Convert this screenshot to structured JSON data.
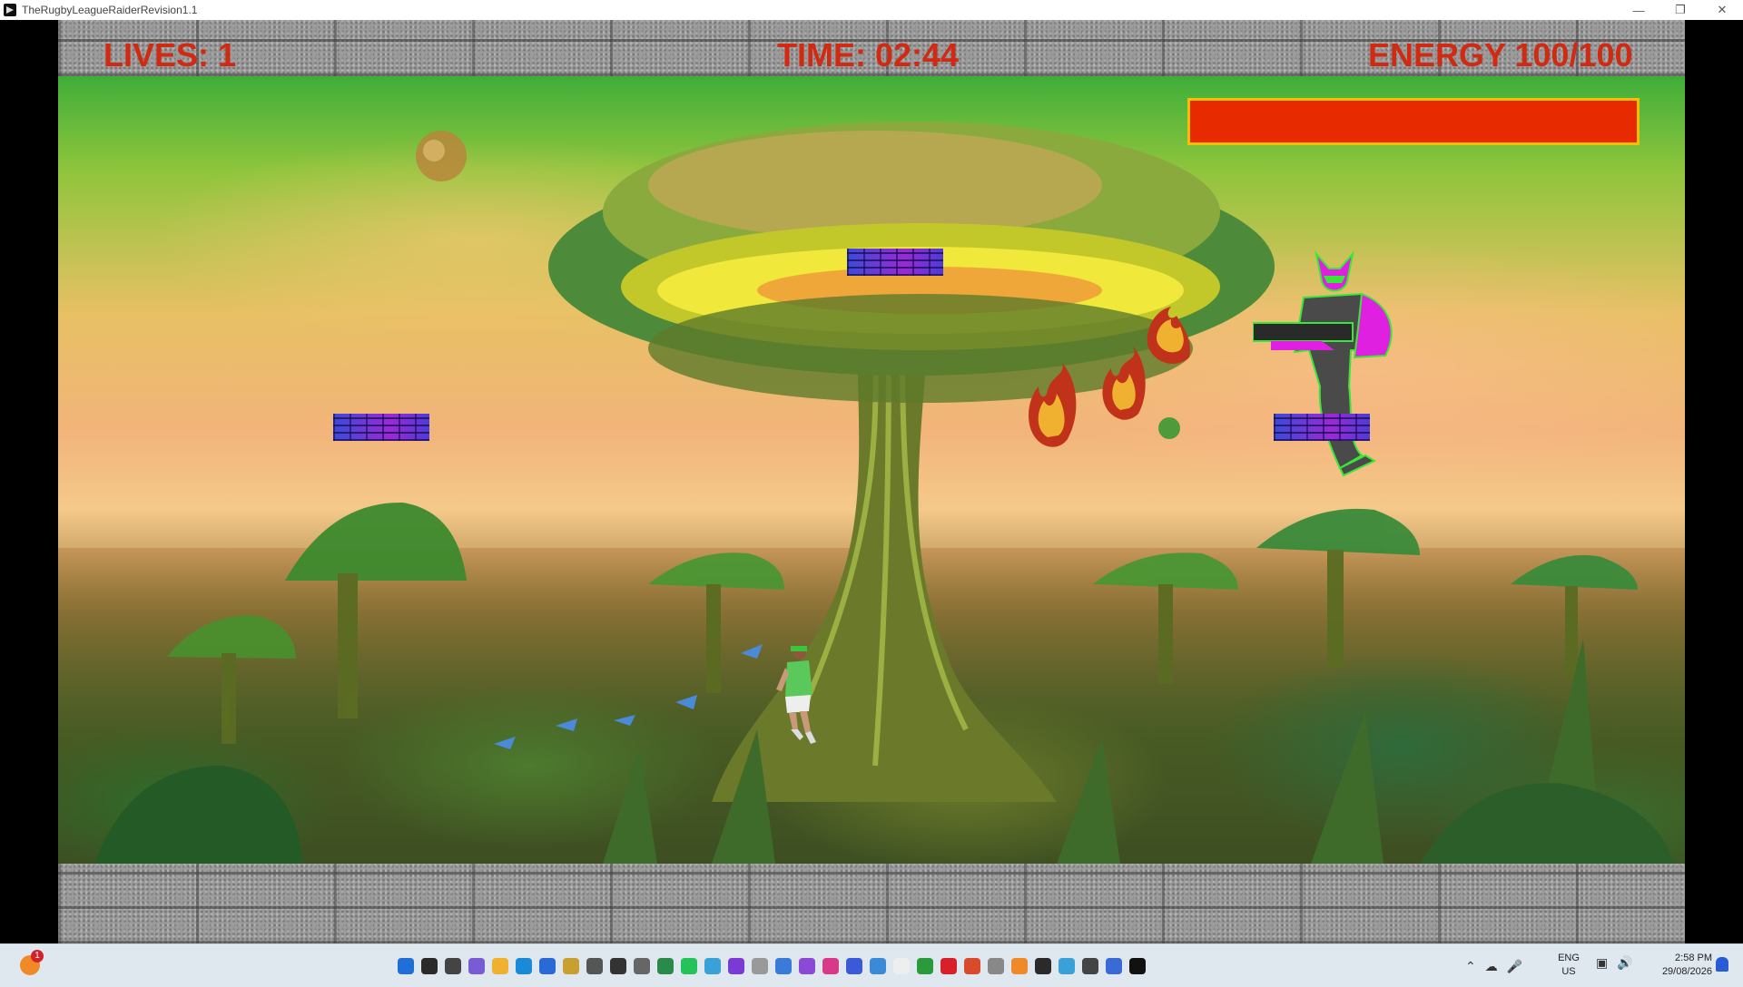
{
  "window": {
    "title": "TheRugbyLeagueRaiderRevision1.1",
    "minimize_icon": "minimize-icon",
    "restore_icon": "restore-icon",
    "close_icon": "close-icon"
  },
  "hud": {
    "lives": "LIVES: 1",
    "time": "TIME: 02:44",
    "energy": "ENERGY 100/100",
    "energy_fraction": 1.0,
    "energy_color": "#e82a00",
    "energy_border": "#f5c000",
    "text_color": "#d02a12"
  },
  "taskbar": {
    "notification_badge": "1",
    "language": "ENG",
    "region": "US",
    "time": "2:58 PM",
    "date": "29/08/2026",
    "pinned_icons": [
      "windows-start-icon",
      "search-icon",
      "task-view-icon",
      "copilot-icon",
      "file-explorer-icon",
      "edge-icon",
      "store-icon",
      "app-icon",
      "notepad-icon",
      "chart-icon",
      "camera-icon",
      "grid-app-icon",
      "whatsapp-icon",
      "app-icon",
      "app-icon",
      "folder-icon",
      "app-icon",
      "app-icon",
      "instagram-icon",
      "app-icon",
      "onedrive-icon",
      "document-icon",
      "xbox-icon",
      "app-icon",
      "app-icon",
      "app-icon",
      "vlc-icon",
      "app-icon",
      "app-icon",
      "settings-icon",
      "app-icon",
      "game-icon"
    ]
  }
}
